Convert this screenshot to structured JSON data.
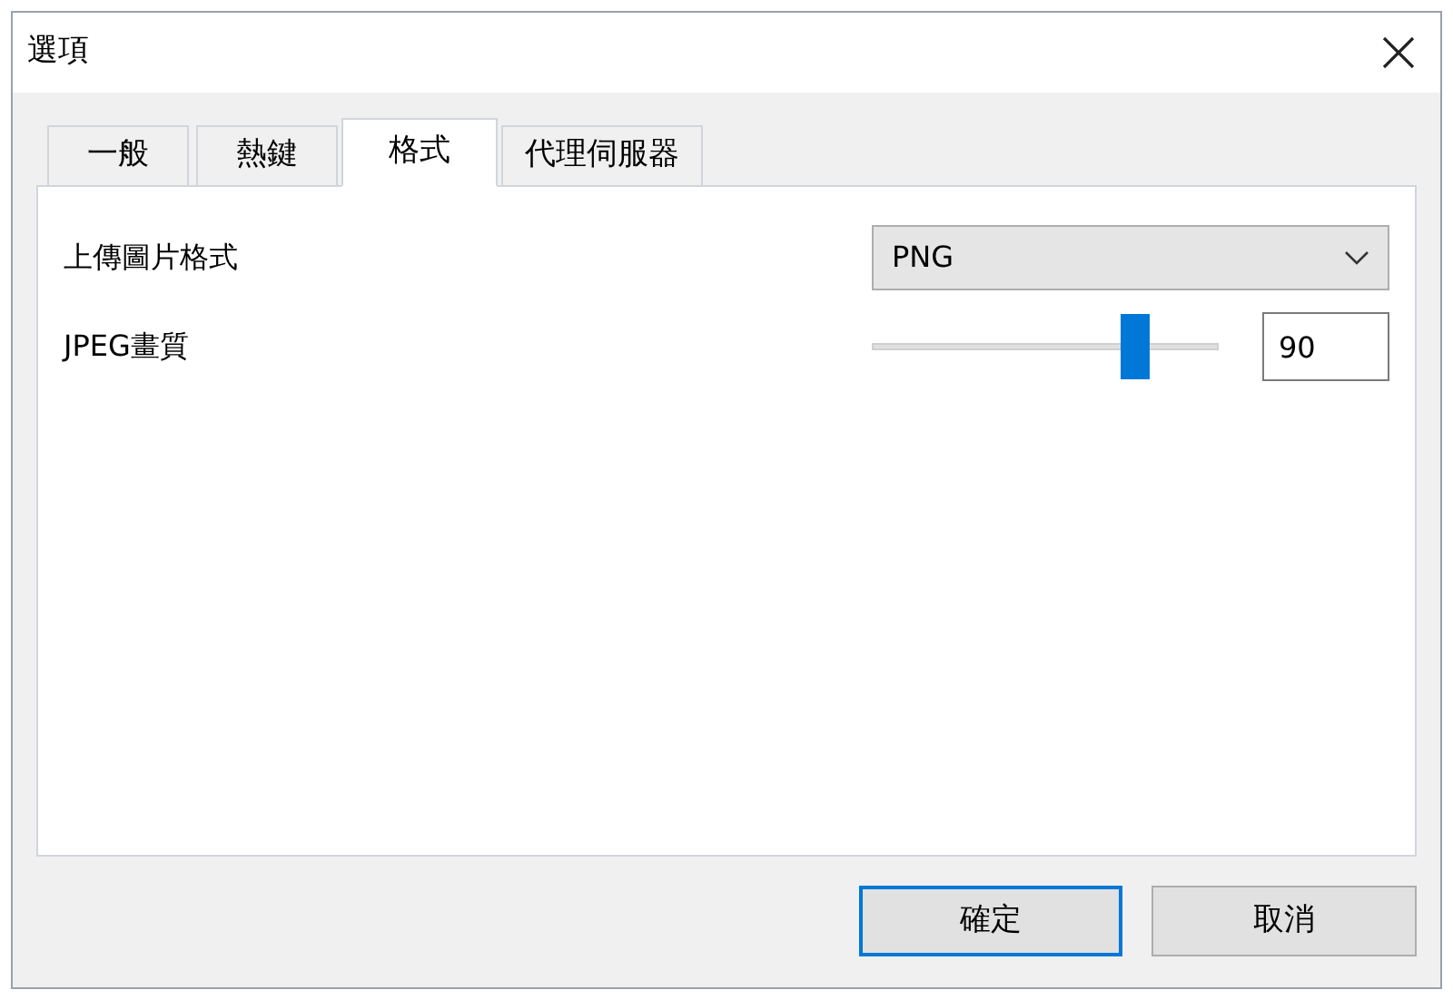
{
  "window": {
    "title": "選項"
  },
  "tabs": [
    {
      "label": "一般",
      "selected": false
    },
    {
      "label": "熱鍵",
      "selected": false
    },
    {
      "label": "格式",
      "selected": true
    },
    {
      "label": "代理伺服器",
      "selected": false
    }
  ],
  "upload_format": {
    "label": "上傳圖片格式",
    "value": "PNG"
  },
  "jpeg_quality": {
    "label": "JPEG畫質",
    "level": 0.78,
    "value": "90"
  },
  "buttons": [
    {
      "label": "確定",
      "selected": true
    },
    {
      "label": "取消",
      "selected": false
    }
  ]
}
